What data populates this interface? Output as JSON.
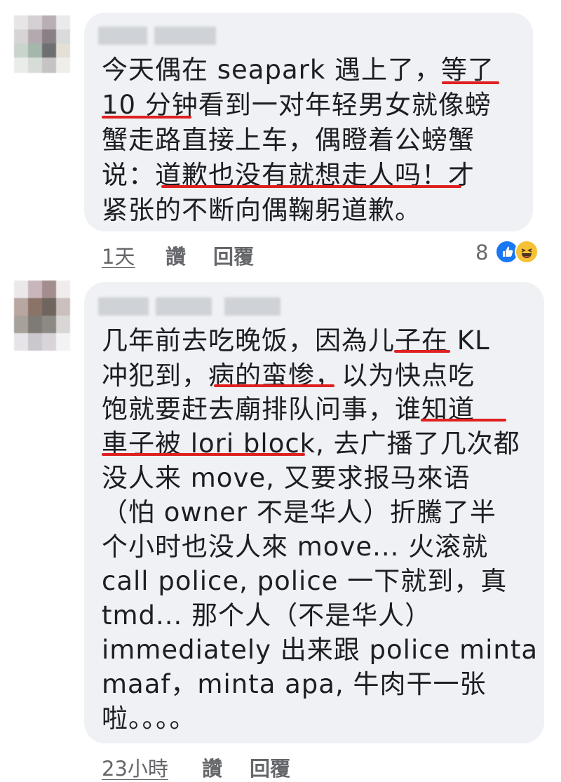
{
  "colors": {
    "bubble": "#eff1f4",
    "text": "#1c1e21",
    "meta": "#65676b",
    "underline": "#e02020",
    "like_blue": "#1877f2",
    "haha_yellow": "#f7c135"
  },
  "comments": [
    {
      "lines": [
        "今天偶在 seapark 遇上了，等了",
        "10 分钟看到一对年轻男女就像螃",
        "蟹走路直接上车，偶瞪着公螃蟹",
        "说：道歉也没有就想走人吗！才",
        "紧张的不断向偶鞠躬道歉。"
      ],
      "time": "1天",
      "like_label": "讚",
      "reply_label": "回覆",
      "reaction_count": "8",
      "reaction_icons": [
        "like-icon",
        "haha-icon"
      ]
    },
    {
      "lines": [
        "几年前去吃晚饭，因為儿子在 KL",
        "冲犯到，病的蛮惨，以为快点吃",
        "饱就要赶去廟排队问事，谁知道",
        "車子被 lori block, 去广播了几次都",
        "没人来 move, 又要求报马來语",
        "（怕 owner 不是华人）折騰了半",
        "个小时也没人來 move... 火滚就",
        "call police, police 一下就到，真",
        "tmd... 那个人（不是华人）",
        "immediately 出来跟 police minta",
        "maaf，minta apa, 牛肉干一张",
        "啦。。。。"
      ],
      "time": "23小時",
      "like_label": "讚",
      "reply_label": "回覆"
    }
  ]
}
